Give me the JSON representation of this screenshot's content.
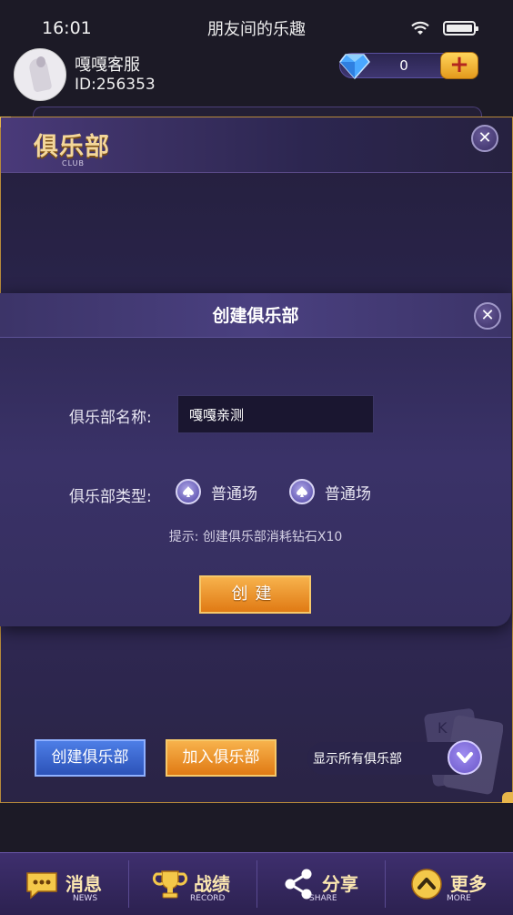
{
  "status_bar": {
    "time": "16:01",
    "title": "朋友间的乐趣"
  },
  "profile": {
    "name": "嘎嘎客服",
    "id": "ID:256353",
    "diamonds": "0"
  },
  "club": {
    "title": "俱乐部",
    "subtitle": "CLUB"
  },
  "modal": {
    "title": "创建俱乐部",
    "name_label": "俱乐部名称:",
    "name_value": "嘎嘎亲测",
    "type_label": "俱乐部类型:",
    "type_options": [
      "普通场",
      "普通场"
    ],
    "hint": "提示: 创建俱乐部消耗钻石X10",
    "create_label": "创建"
  },
  "actions": {
    "create_club": "创建俱乐部",
    "join_club": "加入俱乐部",
    "filter_value": "显示所有俱乐部"
  },
  "nav": [
    {
      "label": "消息",
      "sub": "NEWS",
      "icon": "message-icon"
    },
    {
      "label": "战绩",
      "sub": "RECORD",
      "icon": "trophy-icon"
    },
    {
      "label": "分享",
      "sub": "SHARE",
      "icon": "share-icon"
    },
    {
      "label": "更多",
      "sub": "MORE",
      "icon": "chevron-up-icon"
    }
  ],
  "colors": {
    "accent_gold": "#f4d79a",
    "button_orange": "#e07a14",
    "button_blue": "#2c52b8",
    "panel_purple": "#2f2854"
  }
}
